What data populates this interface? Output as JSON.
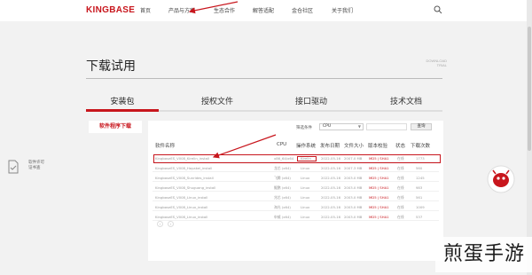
{
  "brand": {
    "logo_text": "KINGBASE",
    "accent": "#c8161d"
  },
  "nav": {
    "items": [
      "首页",
      "产品与方案",
      "生态合作",
      "解答适配",
      "金仓社区",
      "关于我们"
    ]
  },
  "page": {
    "title": "下载试用",
    "download_hint_line1": "DOWNLOAD",
    "download_hint_line2": "TRIAL"
  },
  "tabs": [
    "安装包",
    "授权文件",
    "接口驱动",
    "技术文档"
  ],
  "side": {
    "button": "软件程序下载"
  },
  "left_float": {
    "line1": "软件许可",
    "line2": "证书查"
  },
  "filter": {
    "label": "筛选条件",
    "selected": "CPU",
    "query_button": "查询"
  },
  "table": {
    "headers": [
      "软件名称",
      "CPU",
      "操作系统",
      "发布日期",
      "文件大小",
      "版本校验",
      "状态",
      "下载次数"
    ],
    "rows": [
      {
        "name": "KingbaseES_V008_Kirelin_install",
        "cpu": "x86_64/x64",
        "os": "Kirelin",
        "date": "2022-05-16",
        "size": "2007.0 MB",
        "check": "MD5 | SHA1",
        "status": "在线",
        "count": "1773"
      },
      {
        "name": "KingbaseES_V008_Hayakel_install",
        "cpu": "龙芯 (x64)",
        "os": "Linux",
        "date": "2022-05-16",
        "size": "2007.3 MB",
        "check": "MD5 | SHA1",
        "status": "在线",
        "count": "560"
      },
      {
        "name": "KingbaseES_V008_Sunrides_install",
        "cpu": "飞腾 (x64)",
        "os": "Linux",
        "date": "2022-05-16",
        "size": "2003.0 MB",
        "check": "MD5 | SHA1",
        "status": "在线",
        "count": "1245"
      },
      {
        "name": "KingbaseES_V008_Shuguang_install",
        "cpu": "鲲鹏 (x64)",
        "os": "Linux",
        "date": "2022-05-16",
        "size": "2003.0 MB",
        "check": "MD5 | SHA1",
        "status": "在线",
        "count": "983"
      },
      {
        "name": "KingbaseES_V008_Linux_install",
        "cpu": "兆芯 (x64)",
        "os": "Linux",
        "date": "2022-05-16",
        "size": "2003.0 MB",
        "check": "MD5 | SHA1",
        "status": "在线",
        "count": "561"
      },
      {
        "name": "KingbaseES_V008_Linux_install",
        "cpu": "海光 (x64)",
        "os": "Linux",
        "date": "2022-05-16",
        "size": "2003.0 MB",
        "check": "MD5 | SHA1",
        "status": "在线",
        "count": "1009"
      },
      {
        "name": "KingbaseES_V008_Linux_install",
        "cpu": "申威 (x64)",
        "os": "Linux",
        "date": "2022-05-16",
        "size": "2003.0 MB",
        "check": "MD5 | SHA1",
        "status": "在线",
        "count": "537"
      }
    ]
  },
  "pager": {
    "prev": "‹",
    "next": "›"
  },
  "watermark": "煎蛋手游",
  "icons": {
    "search": "search-icon",
    "mascot": "mascot-icon",
    "doc": "document-icon"
  }
}
